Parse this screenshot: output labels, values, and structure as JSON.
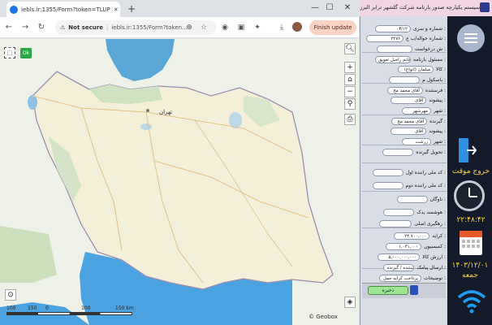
{
  "browser": {
    "tab_title": "iebls.ir:1355/Form?token=TLUP",
    "not_secure": "Not secure",
    "url": "iebls.ir:1355/Form?token...",
    "finish_update": "Finish update"
  },
  "map": {
    "ok_label": "Ok",
    "city_label": "تهران",
    "scale_ticks": [
      "100",
      "150",
      "0",
      "100",
      "150 km"
    ],
    "attribution": "© Geobox"
  },
  "form": {
    "header": "سیستم یکپارچه صدور بارنامه شرکت گلشهر ترابر البرز",
    "fields": [
      {
        "label": "شماره و سری :",
        "value": "۰۳/۱۲"
      },
      {
        "label": "شماره حواله/ب ع :",
        "value": "۲۲۷۶"
      },
      {
        "label": "ش درخواست :",
        "value": ""
      },
      {
        "label": "مسئول بارنامه :",
        "value": "خانم راحیل تعویق"
      },
      {
        "label": "کالا :",
        "value": "مبلمان (انواع)"
      },
      {
        "label": "باسکول م :",
        "value": ""
      },
      {
        "label": "فرستنده :",
        "value": "آقای محمد مح"
      },
      {
        "label": "پیشوند :",
        "value": "آقای"
      },
      {
        "label": "شهر :",
        "value": "مهرشهر"
      },
      {
        "label": "گیرنده :",
        "value": "آقای محمد مح"
      },
      {
        "label": "پیشوند :",
        "value": "آقای"
      },
      {
        "label": "شهر :",
        "value": "زرشت"
      },
      {
        "label": "تحویل گیرنده :",
        "value": ""
      },
      {
        "label": "کد ملی راننده اول :",
        "value": ""
      },
      {
        "label": "کد ملی راننده دوم :",
        "value": ""
      },
      {
        "label": "ناوگان :",
        "value": ""
      },
      {
        "label": "هوشمند یدک :",
        "value": ""
      },
      {
        "label": "رهگیری اصلی :",
        "value": ""
      },
      {
        "label": "کرایه :",
        "value": "۲۴,۷۰۰,۰۰۰"
      },
      {
        "label": "کمیسیون :",
        "value": "۱,۰۴۱,۰۰۰"
      },
      {
        "label": "ارزش کالا :",
        "value": "۵,۰۰۰,۰۰۰,۰۰۰"
      },
      {
        "label": "ارسال پیامک :",
        "value": "فرستنده / گیرنده"
      },
      {
        "label": "توضیحات :",
        "value": "پرداخت کرایه حمل"
      }
    ],
    "save_label": "ذخیره"
  },
  "sidebar": {
    "exit_label": "خروج موقت",
    "time": "۲۲:۴۸:۴۲",
    "date": "۱۴۰۳/۱۲/۰۱",
    "day": "جمعه"
  }
}
